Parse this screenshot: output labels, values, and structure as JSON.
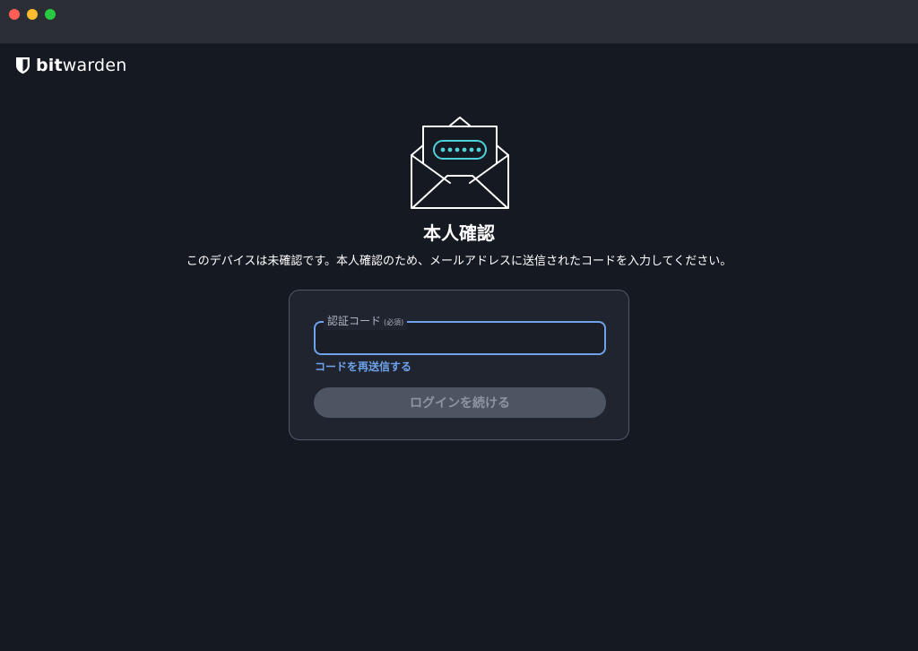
{
  "window": {
    "traffic_lights": {
      "close_color": "#ff5f57",
      "minimize_color": "#febc2e",
      "maximize_color": "#28c840"
    }
  },
  "brand": {
    "logo_icon": "bitwarden-shield-icon",
    "name_bold": "bit",
    "name_regular": "warden"
  },
  "hero": {
    "icon": "envelope-with-code-icon",
    "accent_color": "#4fd1d9"
  },
  "heading": {
    "title": "本人確認",
    "description": "このデバイスは未確認です。本人確認のため、メールアドレスに送信されたコードを入力してください。"
  },
  "form": {
    "code_label": "認証コード",
    "code_required": "(必須)",
    "code_value": "",
    "resend_label": "コードを再送信する",
    "submit_label": "ログインを続ける"
  },
  "colors": {
    "background": "#151922",
    "card": "#1f242e",
    "link": "#6ea2ec",
    "focus_border": "#6ea2ec",
    "disabled_button": "#4d5462"
  }
}
